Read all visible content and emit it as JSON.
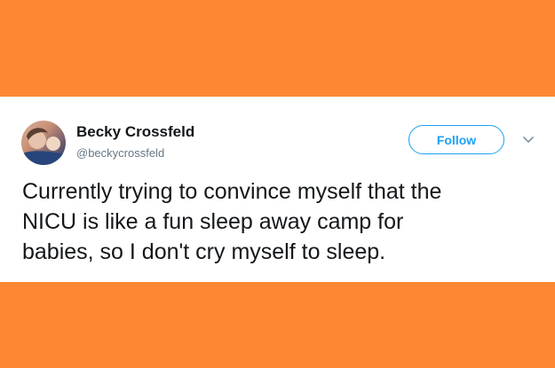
{
  "colors": {
    "background": "#fe8733",
    "card": "#ffffff",
    "accent": "#1da1f2",
    "name_text": "#14171a",
    "handle_text": "#657786"
  },
  "tweet": {
    "author": {
      "display_name": "Becky Crossfeld",
      "handle": "@beckycrossfeld",
      "avatar_icon": "profile-photo"
    },
    "follow_label": "Follow",
    "menu_icon": "chevron-down-icon",
    "text": "Currently trying to convince myself that the\nNICU is like a fun sleep away camp for\nbabies, so I don't cry myself to sleep."
  }
}
